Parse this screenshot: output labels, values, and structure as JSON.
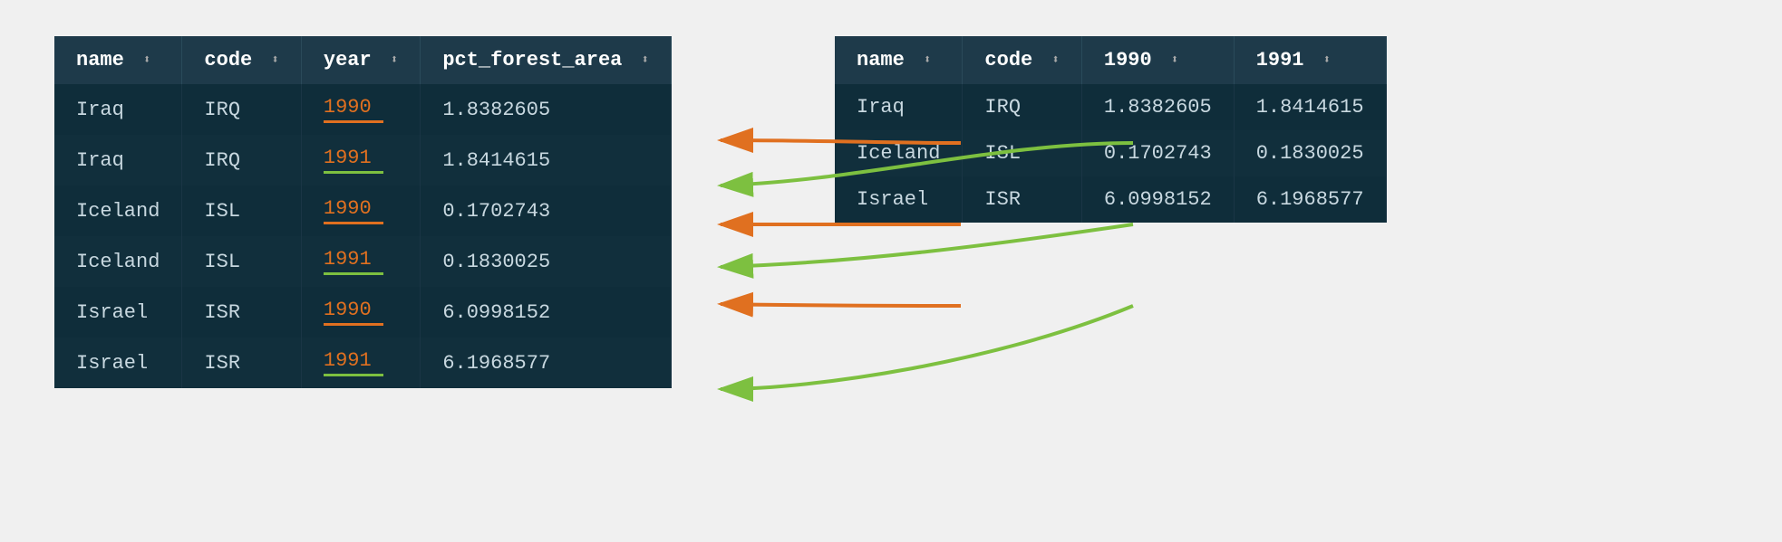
{
  "table1": {
    "columns": [
      {
        "key": "name",
        "label": "name"
      },
      {
        "key": "code",
        "label": "code"
      },
      {
        "key": "year",
        "label": "year"
      },
      {
        "key": "pct_forest_area",
        "label": "pct_forest_area"
      }
    ],
    "rows": [
      {
        "name": "Iraq",
        "code": "IRQ",
        "year": "1990",
        "pct_forest_area": "1.8382605",
        "year_color": "orange"
      },
      {
        "name": "Iraq",
        "code": "IRQ",
        "year": "1991",
        "pct_forest_area": "1.8414615",
        "year_color": "green"
      },
      {
        "name": "Iceland",
        "code": "ISL",
        "year": "1990",
        "pct_forest_area": "0.1702743",
        "year_color": "orange"
      },
      {
        "name": "Iceland",
        "code": "ISL",
        "year": "1991",
        "pct_forest_area": "0.1830025",
        "year_color": "green"
      },
      {
        "name": "Israel",
        "code": "ISR",
        "year": "1990",
        "pct_forest_area": "6.0998152",
        "year_color": "orange"
      },
      {
        "name": "Israel",
        "code": "ISR",
        "year": "1991",
        "pct_forest_area": "6.1968577",
        "year_color": "green"
      }
    ]
  },
  "table2": {
    "columns": [
      {
        "key": "name",
        "label": "name"
      },
      {
        "key": "code",
        "label": "code"
      },
      {
        "key": "y1990",
        "label": "1990"
      },
      {
        "key": "y1991",
        "label": "1991"
      }
    ],
    "rows": [
      {
        "name": "Iraq",
        "code": "IRQ",
        "y1990": "1.8382605",
        "y1991": "1.8414615"
      },
      {
        "name": "Iceland",
        "code": "ISL",
        "y1990": "0.1702743",
        "y1991": "0.1830025"
      },
      {
        "name": "Israel",
        "code": "ISR",
        "y1990": "6.0998152",
        "y1991": "6.1968577"
      }
    ]
  }
}
